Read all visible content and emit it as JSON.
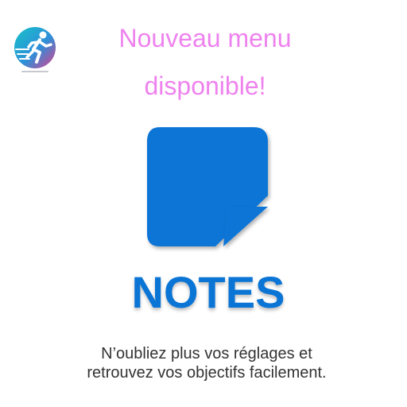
{
  "app": {
    "logo_icon": "running-person-logo-icon"
  },
  "announcement": {
    "headline_line1": "Nouveau menu",
    "headline_line2": "disponible!",
    "headline_color": "#ee82ee"
  },
  "feature": {
    "icon": "sticky-note-icon",
    "title": "NOTES",
    "accent_color": "#0b75d6"
  },
  "description": {
    "line1": "N’oubliez plus vos réglages et",
    "line2": "retrouvez vos objectifs facilement."
  }
}
